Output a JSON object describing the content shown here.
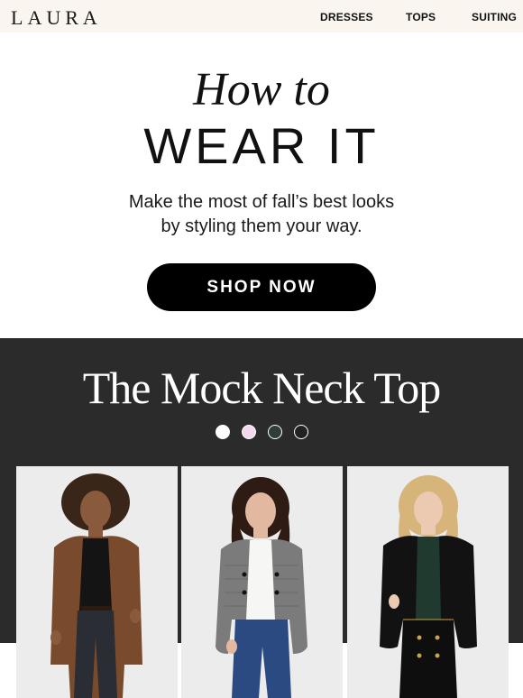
{
  "header": {
    "logo": "LAURA",
    "nav": [
      {
        "label": "DRESSES"
      },
      {
        "label": "TOPS"
      },
      {
        "label": "SUITING"
      }
    ]
  },
  "hero": {
    "script_title": "How to",
    "title": "WEAR IT",
    "subtitle_line1": "Make the most of fall’s best looks",
    "subtitle_line2": "by styling them your way.",
    "cta_label": "SHOP NOW"
  },
  "feature": {
    "title": "The Mock Neck Top",
    "swatches": [
      {
        "color": "#ffffff"
      },
      {
        "color": "#f4d9ee"
      },
      {
        "color": "#2f3e38"
      },
      {
        "color": "#222222"
      }
    ],
    "photos": [
      {
        "icon": "model-photo-brown-cardigan"
      },
      {
        "icon": "model-photo-tweed-jacket"
      },
      {
        "icon": "model-photo-leather-jacket"
      }
    ]
  },
  "colors": {
    "header_bg": "#faf6ef",
    "dark_section_bg": "#2b2b2b",
    "button_bg": "#000000"
  }
}
